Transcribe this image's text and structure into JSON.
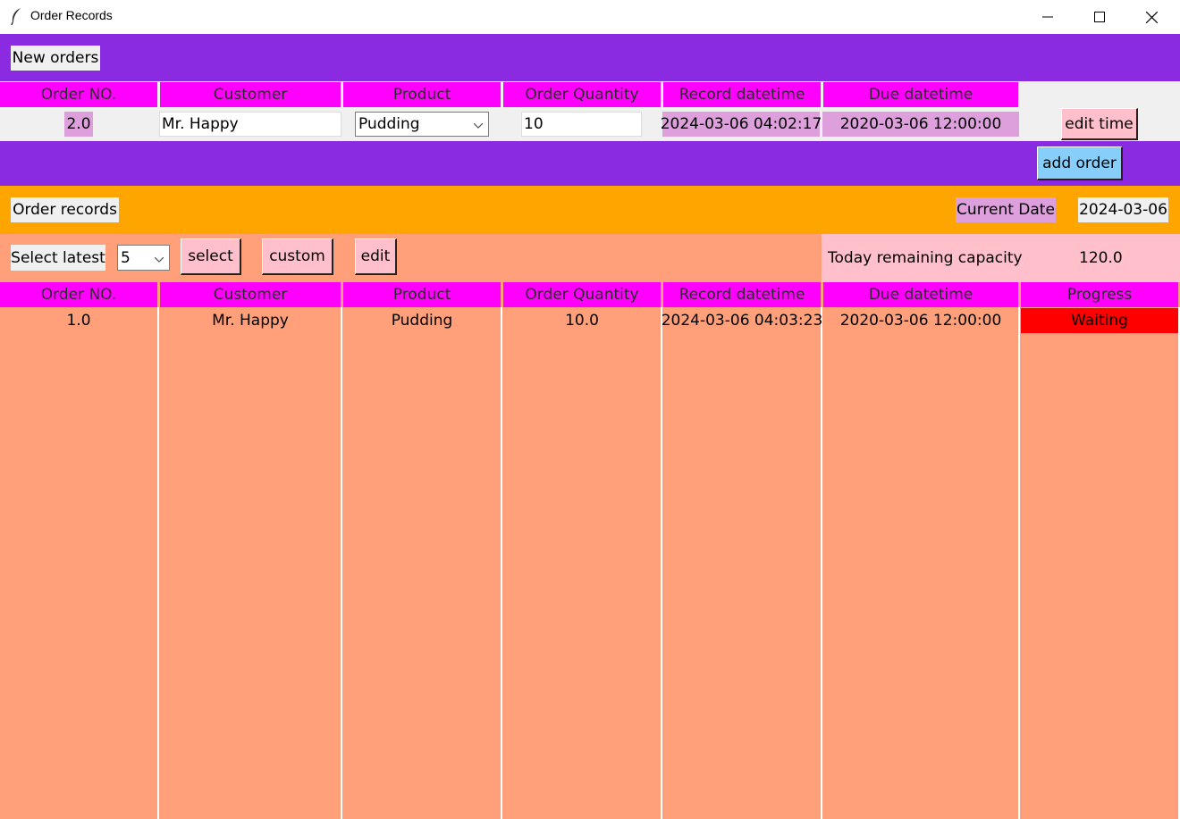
{
  "window": {
    "title": "Order Records"
  },
  "new_orders": {
    "section_label": "New orders",
    "columns": [
      "Order NO.",
      "Customer",
      "Product",
      "Order Quantity",
      "Record datetime",
      "Due datetime"
    ],
    "order_no": "2.0",
    "customer_value": "Mr. Happy",
    "product_value": "Pudding",
    "quantity_value": "10",
    "record_datetime": "2024-03-06 04:02:17",
    "due_datetime": "2020-03-06 12:00:00",
    "edit_time_label": "edit time",
    "add_order_label": "add order"
  },
  "records": {
    "section_label": "Order records",
    "current_date_label": "Current Date",
    "current_date_value": "2024-03-06",
    "select_latest_label": "Select latest",
    "select_latest_value": "5",
    "select_label": "select",
    "custom_label": "custom",
    "edit_label": "edit",
    "capacity_label": "Today remaining capacity",
    "capacity_value": "120.0",
    "columns": [
      "Order NO.",
      "Customer",
      "Product",
      "Order Quantity",
      "Record datetime",
      "Due datetime",
      "Progress"
    ],
    "rows": [
      {
        "order_no": "1.0",
        "customer": "Mr. Happy",
        "product": "Pudding",
        "quantity": "10.0",
        "record_datetime": "2024-03-06 04:03:23",
        "due_datetime": "2020-03-06 12:00:00",
        "progress": "Waiting"
      }
    ]
  },
  "colors": {
    "purple": "#8a2be2",
    "magenta": "#ff00ff",
    "orange": "#ffa500",
    "salmon": "#ffa07a",
    "pink": "#ffc0cb",
    "plum": "#dda0dd",
    "status_waiting": "#ff0000",
    "add_button": "#87cefa"
  }
}
